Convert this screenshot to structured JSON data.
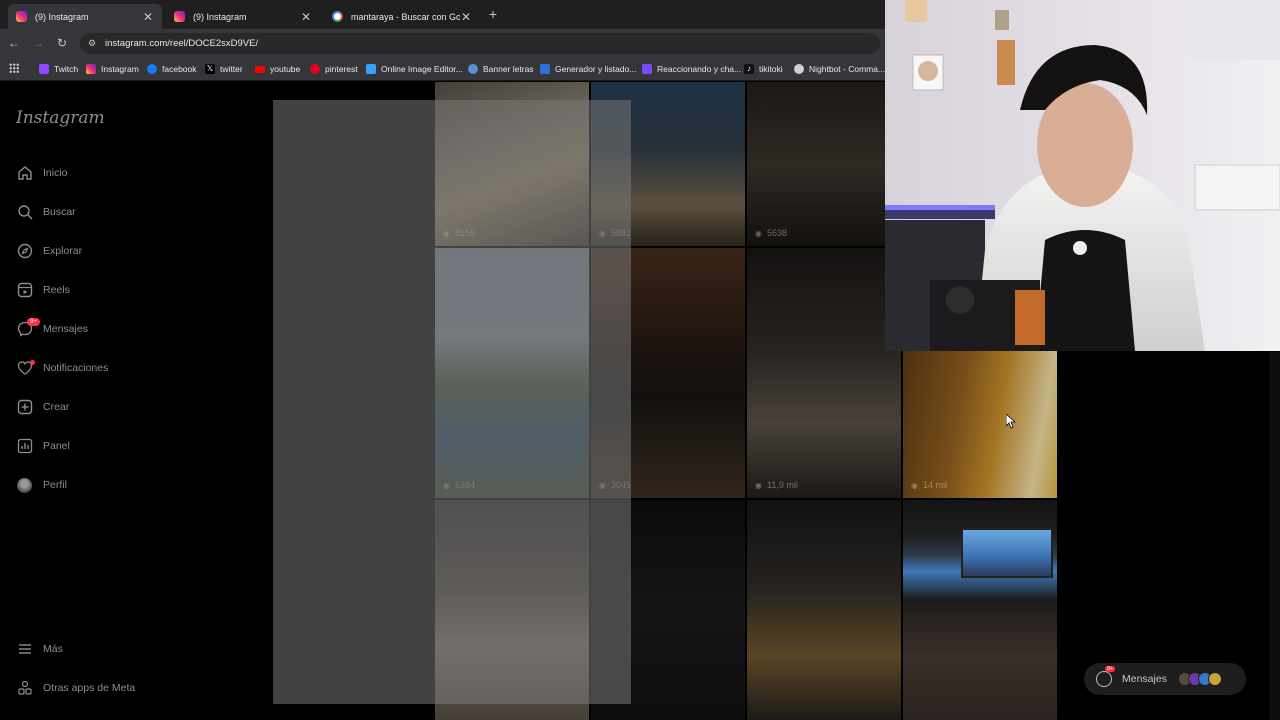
{
  "browser": {
    "tabs": [
      {
        "title": "(9) Instagram",
        "active": true,
        "favicon": "instagram-icon"
      },
      {
        "title": "(9) Instagram",
        "active": false,
        "favicon": "instagram-icon"
      },
      {
        "title": "mantaraya - Buscar con Google",
        "active": false,
        "favicon": "google-icon"
      }
    ],
    "url": "instagram.com/reel/DOCE2sxD9VE/",
    "bookmarks": [
      {
        "label": "Twitch",
        "color": "#9146ff"
      },
      {
        "label": "Instagram",
        "color": "#e1306c"
      },
      {
        "label": "facebook",
        "color": "#1877f2"
      },
      {
        "label": "twitter",
        "color": "#000000"
      },
      {
        "label": "youtube",
        "color": "#ff0000"
      },
      {
        "label": "pinterest",
        "color": "#e60023"
      },
      {
        "label": "Online Image Editor...",
        "color": "#3aa0ff"
      },
      {
        "label": "Banner letras",
        "color": "#5c8fd6"
      },
      {
        "label": "Generador y listado...",
        "color": "#2f6fd8"
      },
      {
        "label": "Reaccionando y cha...",
        "color": "#7a4cff"
      },
      {
        "label": "tikitoki",
        "color": "#111111"
      },
      {
        "label": "Nightbot - Comma...",
        "color": "#2b2b2b"
      }
    ]
  },
  "instagram": {
    "logo": "Instagram",
    "nav": [
      {
        "label": "Inicio",
        "icon": "home-icon"
      },
      {
        "label": "Buscar",
        "icon": "search-icon"
      },
      {
        "label": "Explorar",
        "icon": "compass-icon"
      },
      {
        "label": "Reels",
        "icon": "reels-icon"
      },
      {
        "label": "Mensajes",
        "icon": "messenger-icon",
        "badge": "9+"
      },
      {
        "label": "Notificaciones",
        "icon": "heart-icon"
      },
      {
        "label": "Crear",
        "icon": "plus-square-icon"
      },
      {
        "label": "Panel",
        "icon": "chart-icon"
      },
      {
        "label": "Perfil",
        "icon": "avatar-icon"
      }
    ],
    "more": {
      "label": "Más",
      "icon": "menu-icon"
    },
    "meta_apps": {
      "label": "Otras apps de Meta",
      "icon": "meta-apps-icon"
    },
    "grid_views": [
      "8156",
      "5682",
      "5638",
      "6384",
      "3045",
      "11,9 mil",
      "14 mil"
    ],
    "messages_pill": {
      "label": "Mensajes",
      "badge": "9+"
    }
  },
  "colors": {
    "accent_badge": "#ff3040",
    "sidebar_text": "#8e8e8e",
    "chrome_bg": "#35363a"
  }
}
